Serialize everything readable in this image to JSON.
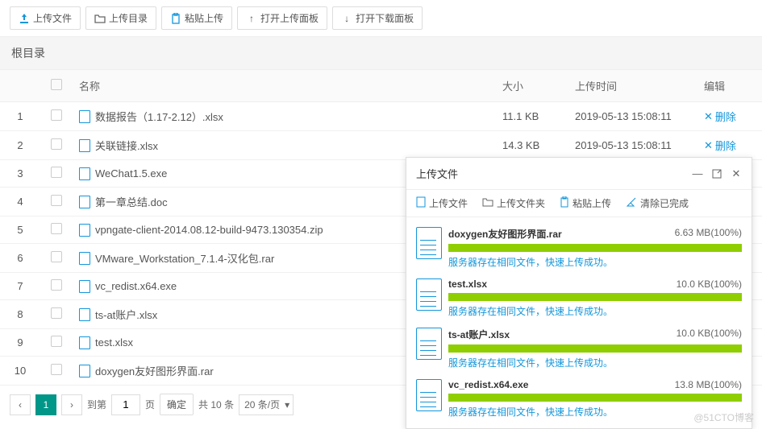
{
  "toolbar": {
    "upload_file": "上传文件",
    "upload_dir": "上传目录",
    "paste_upload": "粘贴上传",
    "open_upload_panel": "打开上传面板",
    "open_download_panel": "打开下载面板"
  },
  "breadcrumb": "根目录",
  "columns": {
    "name": "名称",
    "size": "大小",
    "time": "上传时间",
    "edit": "编辑"
  },
  "rows": [
    {
      "idx": "1",
      "name": "数据报告（1.17-2.12）.xlsx",
      "size": "11.1 KB",
      "time": "2019-05-13 15:08:11",
      "del": "删除"
    },
    {
      "idx": "2",
      "name": "关联链接.xlsx",
      "size": "14.3 KB",
      "time": "2019-05-13 15:08:11",
      "del": "删除"
    },
    {
      "idx": "3",
      "name": "WeChat1.5.exe",
      "size": "",
      "time": "",
      "del": ""
    },
    {
      "idx": "4",
      "name": "第一章总结.doc",
      "size": "",
      "time": "",
      "del": ""
    },
    {
      "idx": "5",
      "name": "vpngate-client-2014.08.12-build-9473.130354.zip",
      "size": "",
      "time": "",
      "del": ""
    },
    {
      "idx": "6",
      "name": "VMware_Workstation_7.1.4-汉化包.rar",
      "size": "",
      "time": "",
      "del": ""
    },
    {
      "idx": "7",
      "name": "vc_redist.x64.exe",
      "size": "",
      "time": "",
      "del": ""
    },
    {
      "idx": "8",
      "name": "ts-at账户.xlsx",
      "size": "",
      "time": "",
      "del": ""
    },
    {
      "idx": "9",
      "name": "test.xlsx",
      "size": "",
      "time": "",
      "del": ""
    },
    {
      "idx": "10",
      "name": "doxygen友好图形界面.rar",
      "size": "",
      "time": "",
      "del": ""
    }
  ],
  "pager": {
    "current": "1",
    "goto_label": "到第",
    "page_label": "页",
    "confirm": "确定",
    "total": "共 10 条",
    "per_page": "20 条/页"
  },
  "upload_panel": {
    "title": "上传文件",
    "tabs": {
      "file": "上传文件",
      "folder": "上传文件夹",
      "paste": "粘贴上传",
      "clear": "清除已完成"
    },
    "items": [
      {
        "name": "doxygen友好图形界面.rar",
        "size": "6.63 MB(100%)",
        "msg": "服务器存在相同文件，快速上传成功。"
      },
      {
        "name": "test.xlsx",
        "size": "10.0 KB(100%)",
        "msg": "服务器存在相同文件，快速上传成功。"
      },
      {
        "name": "ts-at账户.xlsx",
        "size": "10.0 KB(100%)",
        "msg": "服务器存在相同文件，快速上传成功。"
      },
      {
        "name": "vc_redist.x64.exe",
        "size": "13.8 MB(100%)",
        "msg": "服务器存在相同文件，快速上传成功。"
      }
    ]
  },
  "watermark": "@51CTO博客"
}
